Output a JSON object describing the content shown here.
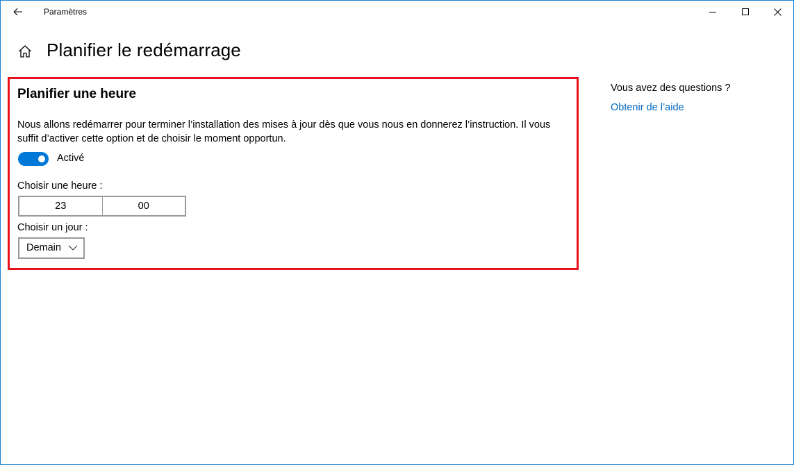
{
  "window": {
    "title": "Paramètres",
    "accent_color": "#0078d7",
    "border_color": "#1883d7"
  },
  "icons": {
    "back": "back-arrow-icon",
    "home": "home-icon",
    "minimize": "minimize-icon",
    "maximize": "maximize-icon",
    "close": "close-icon",
    "dropdown": "chevron-down-icon"
  },
  "header": {
    "title": "Planifier le redémarrage"
  },
  "schedule": {
    "section_title": "Planifier une heure",
    "description": "Nous allons redémarrer pour terminer l’installation des mises à jour dès que vous nous en donnerez l’instruction. Il vous suffit d’activer cette option et de choisir le moment opportun.",
    "toggle": {
      "state": "on",
      "label": "Activé"
    },
    "time": {
      "label": "Choisir une heure :",
      "hour": "23",
      "minute": "00"
    },
    "day": {
      "label": "Choisir un jour :",
      "selected": "Demain"
    },
    "highlight_color": "#e8101a"
  },
  "side": {
    "question": "Vous avez des questions ?",
    "help_link": "Obtenir de l’aide",
    "link_color": "#0067c0"
  }
}
